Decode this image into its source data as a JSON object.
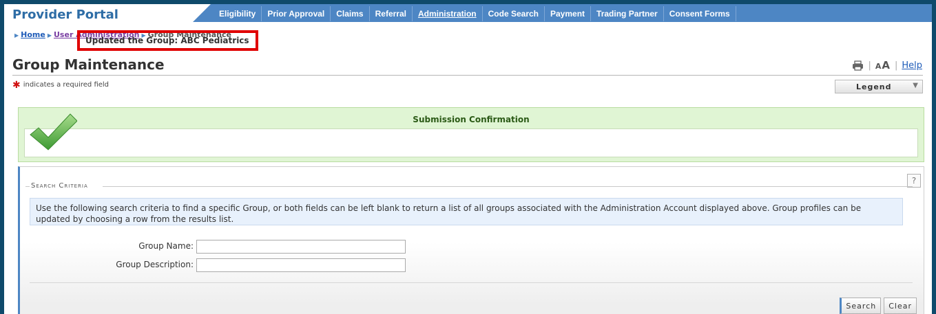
{
  "header": {
    "title": "Provider Portal",
    "tabs": [
      {
        "label": "Eligibility"
      },
      {
        "label": "Prior Approval"
      },
      {
        "label": "Claims"
      },
      {
        "label": "Referral"
      },
      {
        "label": "Administration",
        "active": true
      },
      {
        "label": "Code Search"
      },
      {
        "label": "Payment"
      },
      {
        "label": "Trading Partner"
      },
      {
        "label": "Consent Forms"
      }
    ]
  },
  "breadcrumb": {
    "home": "Home",
    "user_admin": "User Administration",
    "current": "Group Maintenance"
  },
  "page": {
    "title": "Group Maintenance",
    "required_note": "indicates a required field",
    "font_small": "A",
    "font_big": "A",
    "help": "Help",
    "legend": "Legend"
  },
  "confirmation": {
    "heading": "Submission Confirmation",
    "message": "Updated the Group: ABC Pediatrics"
  },
  "search": {
    "legend": "Search Criteria",
    "help_glyph": "?",
    "instructions": "Use the following search criteria to find a specific Group, or both fields can be left blank to return a list of all groups associated with the Administration Account displayed above. Group profiles can be updated by choosing a row from the results list.",
    "group_name_label": "Group Name:",
    "group_name_value": "",
    "group_desc_label": "Group Description:",
    "group_desc_value": "",
    "search_button": "Search",
    "clear_button": "Clear"
  },
  "colors": {
    "nav_bar": "#4d86c4",
    "title_blue": "#2e6da6",
    "confirm_bg": "#e0f5d4",
    "highlight_red": "#e00000"
  }
}
